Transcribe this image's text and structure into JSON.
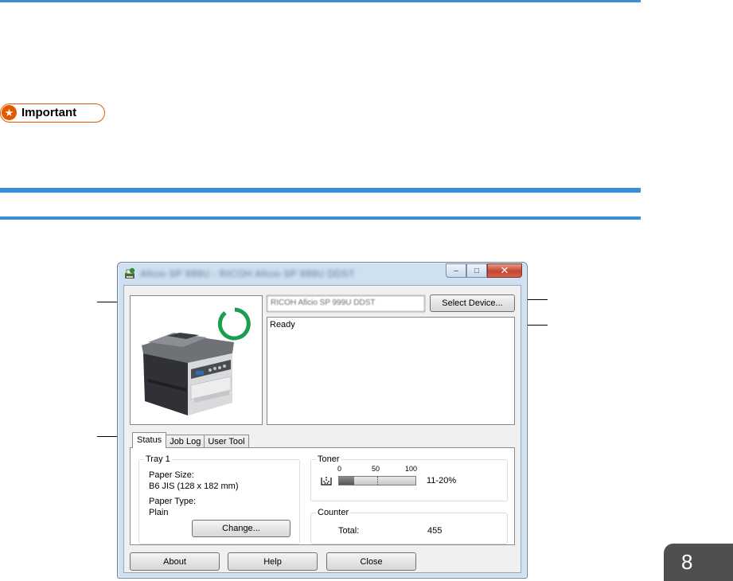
{
  "important_label": "Important",
  "window": {
    "title": "Aficio SP 999U - RICOH Aficio SP 999U DDST",
    "device_name": "RICOH Aficio SP 999U DDST",
    "select_device_label": "Select Device...",
    "status_message": "Ready",
    "tabs": [
      {
        "label": "Status",
        "active": true
      },
      {
        "label": "Job Log",
        "active": false
      },
      {
        "label": "User Tool",
        "active": false
      }
    ],
    "tray": {
      "legend": "Tray 1",
      "paper_size_label": "Paper Size:",
      "paper_size_value": "B6 JIS (128 x 182 mm)",
      "paper_type_label": "Paper Type:",
      "paper_type_value": "Plain",
      "change_label": "Change..."
    },
    "toner": {
      "legend": "Toner",
      "scale": [
        "0",
        "50",
        "100"
      ],
      "level_text": "11-20%",
      "level_fraction": 0.2
    },
    "counter": {
      "legend": "Counter",
      "total_label": "Total:",
      "total_value": "455"
    },
    "buttons": {
      "about": "About",
      "help": "Help",
      "close": "Close"
    },
    "controls": {
      "minimize": "–",
      "maximize": "□",
      "close": "✕"
    }
  },
  "chapter_number": "8",
  "colors": {
    "rule_blue": "#3a8fd6",
    "important_orange": "#e25a00",
    "ready_ring_green": "#1a9e50",
    "chapter_tab_gray": "#4f4f4f"
  }
}
